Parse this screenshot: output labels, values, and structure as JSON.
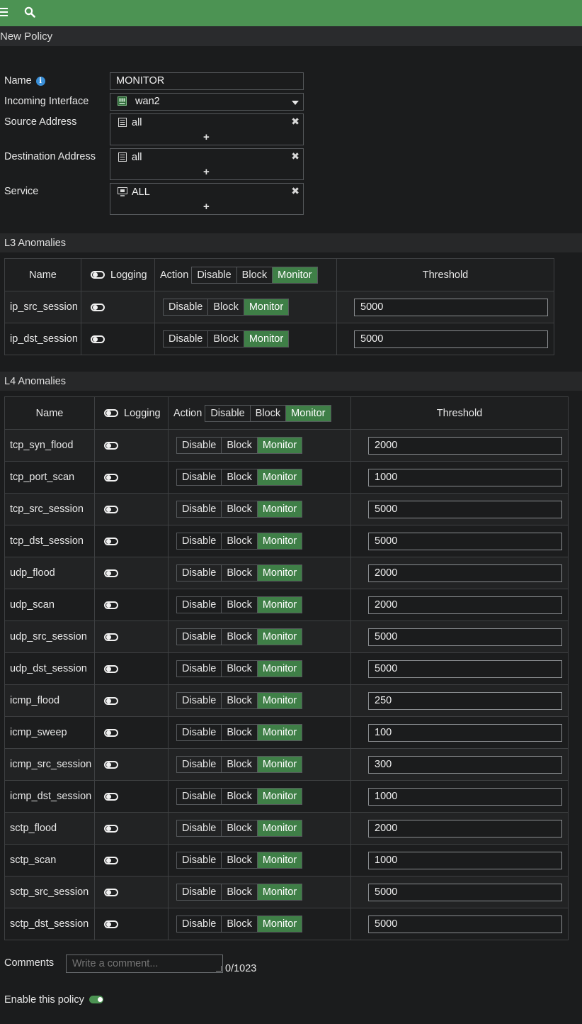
{
  "header": {
    "title": "New Policy"
  },
  "form": {
    "name_label": "Name",
    "name_value": "MONITOR",
    "incoming_label": "Incoming Interface",
    "incoming_value": "wan2",
    "source_label": "Source Address",
    "source_value": "all",
    "dest_label": "Destination Address",
    "dest_value": "all",
    "service_label": "Service",
    "service_value": "ALL",
    "add_symbol": "+"
  },
  "columns": {
    "name": "Name",
    "logging": "Logging",
    "action": "Action",
    "threshold": "Threshold",
    "disable": "Disable",
    "block": "Block",
    "monitor": "Monitor"
  },
  "l3": {
    "title": "L3 Anomalies",
    "rows": [
      {
        "name": "ip_src_session",
        "threshold": "5000"
      },
      {
        "name": "ip_dst_session",
        "threshold": "5000"
      }
    ]
  },
  "l4": {
    "title": "L4 Anomalies",
    "rows": [
      {
        "name": "tcp_syn_flood",
        "threshold": "2000"
      },
      {
        "name": "tcp_port_scan",
        "threshold": "1000"
      },
      {
        "name": "tcp_src_session",
        "threshold": "5000"
      },
      {
        "name": "tcp_dst_session",
        "threshold": "5000"
      },
      {
        "name": "udp_flood",
        "threshold": "2000"
      },
      {
        "name": "udp_scan",
        "threshold": "2000"
      },
      {
        "name": "udp_src_session",
        "threshold": "5000"
      },
      {
        "name": "udp_dst_session",
        "threshold": "5000"
      },
      {
        "name": "icmp_flood",
        "threshold": "250"
      },
      {
        "name": "icmp_sweep",
        "threshold": "100"
      },
      {
        "name": "icmp_src_session",
        "threshold": "300"
      },
      {
        "name": "icmp_dst_session",
        "threshold": "1000"
      },
      {
        "name": "sctp_flood",
        "threshold": "2000"
      },
      {
        "name": "sctp_scan",
        "threshold": "1000"
      },
      {
        "name": "sctp_src_session",
        "threshold": "5000"
      },
      {
        "name": "sctp_dst_session",
        "threshold": "5000"
      }
    ]
  },
  "comments": {
    "label": "Comments",
    "placeholder": "Write a comment...",
    "count": "0/1023"
  },
  "enable": {
    "label": "Enable this policy",
    "state": "on"
  },
  "colors": {
    "accent": "#4c9353",
    "active_segment": "#3f7f47"
  },
  "icons": {
    "menu": "hamburger-icon",
    "search": "search-icon",
    "info": "info-icon",
    "interface": "port-icon",
    "address": "address-icon",
    "service": "service-icon",
    "remove": "close-icon"
  }
}
